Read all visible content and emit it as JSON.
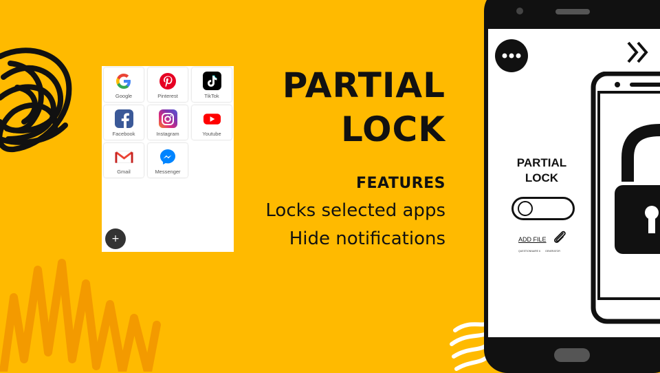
{
  "colors": {
    "background": "#FFBA00",
    "scribble": "#111111",
    "squiggle_orange": "#F39A00",
    "text": "#111111",
    "phone_body": "#111111"
  },
  "apps": [
    {
      "label": "Google",
      "icon": "google-g-icon"
    },
    {
      "label": "Pinterest",
      "icon": "pinterest-icon"
    },
    {
      "label": "TikTok",
      "icon": "tiktok-icon"
    },
    {
      "label": "Facebook",
      "icon": "facebook-icon"
    },
    {
      "label": "Instagram",
      "icon": "instagram-icon"
    },
    {
      "label": "Youtube",
      "icon": "youtube-icon"
    },
    {
      "label": "Gmail",
      "icon": "gmail-icon"
    },
    {
      "label": "Messenger",
      "icon": "messenger-icon"
    }
  ],
  "fab_label": "+",
  "title": {
    "line1": "PARTIAL",
    "line2": "LOCK"
  },
  "features": {
    "heading": "FEATURES",
    "items": [
      "Locks selected apps",
      "Hide notifications"
    ]
  },
  "phone": {
    "lock_title_line1": "PARTIAL",
    "lock_title_line2": "LOCK",
    "add_file": "ADD FILE",
    "tiny_left": "QUESTIONNAIRE 6",
    "tiny_right": "GENERATOR",
    "toggle_on": false,
    "menu_icon": "more-dots-icon",
    "skip_icon": "double-chevron-right-icon"
  }
}
